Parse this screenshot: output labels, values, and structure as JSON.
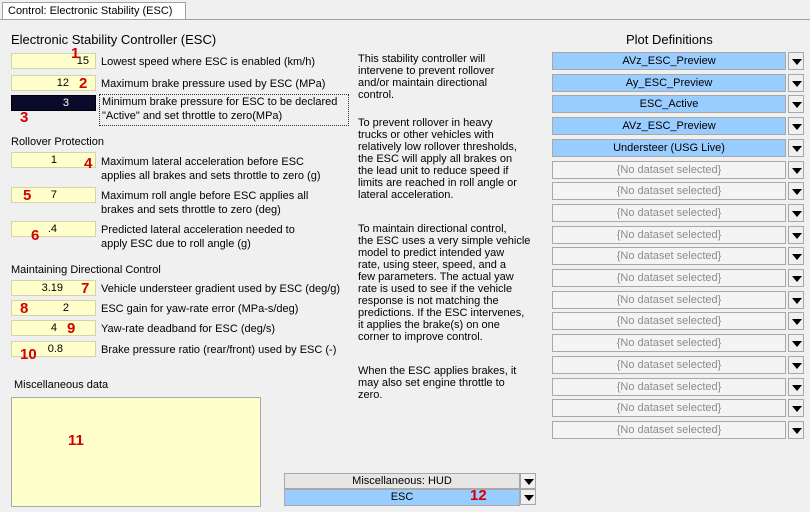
{
  "tab": {
    "label": "Control: Electronic Stability (ESC)"
  },
  "title": "Electronic Stability Controller (ESC)",
  "fields": [
    {
      "value": "15",
      "label": "Lowest speed where ESC is enabled (km/h)",
      "marker": "1"
    },
    {
      "value": "12",
      "label": "Maximum brake pressure used by ESC (MPa)",
      "marker": "2"
    },
    {
      "value": "3",
      "label_lines": [
        "Minimum brake pressure for ESC to be declared",
        "\"Active\" and set throttle to zero(MPa)"
      ],
      "marker": "3"
    }
  ],
  "rollover": {
    "heading": "Rollover Protection",
    "fields": [
      {
        "value": "1",
        "label_lines": [
          "Maximum lateral acceleration before ESC",
          "applies all brakes and sets throttle to zero (g)"
        ],
        "marker": "4"
      },
      {
        "value": "7",
        "label_lines": [
          "Maximum roll angle before ESC applies all",
          "brakes and sets throttle to zero (deg)"
        ],
        "marker": "5"
      },
      {
        "value": ".4",
        "label_lines": [
          "Predicted lateral acceleration needed to",
          "apply ESC due to roll angle (g)"
        ],
        "marker": "6"
      }
    ]
  },
  "directional": {
    "heading": "Maintaining Directional Control",
    "fields": [
      {
        "value": "3.19",
        "label": "Vehicle understeer gradient used by ESC (deg/g)",
        "marker": "7"
      },
      {
        "value": "2",
        "label": "ESC gain for yaw-rate error (MPa-s/deg)",
        "marker": "8"
      },
      {
        "value": "4",
        "label": "Yaw-rate deadband for ESC (deg/s)",
        "marker": "9"
      },
      {
        "value": "0.8",
        "label": "Brake pressure ratio (rear/front) used by ESC (-)",
        "marker": "10"
      }
    ]
  },
  "misc": {
    "heading": "Miscellaneous data",
    "marker": "11"
  },
  "description": [
    [
      "This stability controller will",
      "intervene to prevent rollover",
      "and/or maintain directional",
      "control."
    ],
    [
      "To prevent rollover in heavy",
      "trucks or other vehicles with",
      "relatively low rollover thresholds,",
      "the ESC will apply all brakes on",
      "the lead unit to reduce speed if",
      "limits are reached in roll angle or",
      "lateral acceleration."
    ],
    [
      "To maintain directional control,",
      "the ESC uses a very simple vehicle",
      "model to predict intended yaw",
      "rate, using steer, speed, and a",
      "few parameters. The actual yaw",
      "rate is used to see if the vehicle",
      "response is not matching the",
      "predictions. If the ESC intervenes,",
      "it applies the brake(s) on one",
      "corner to improve control."
    ],
    [
      "When the ESC applies brakes, it",
      "may also set engine throttle to",
      "zero."
    ]
  ],
  "plots": {
    "heading": "Plot Definitions",
    "items": [
      {
        "label": "AVz_ESC_Preview",
        "active": true
      },
      {
        "label": "Ay_ESC_Preview",
        "active": true
      },
      {
        "label": "ESC_Active",
        "active": true
      },
      {
        "label": "AVz_ESC_Preview",
        "active": true
      },
      {
        "label": "Understeer (USG Live)",
        "active": true
      },
      {
        "label": "{No dataset selected}",
        "active": false
      },
      {
        "label": "{No dataset selected}",
        "active": false
      },
      {
        "label": "{No dataset selected}",
        "active": false
      },
      {
        "label": "{No dataset selected}",
        "active": false
      },
      {
        "label": "{No dataset selected}",
        "active": false
      },
      {
        "label": "{No dataset selected}",
        "active": false
      },
      {
        "label": "{No dataset selected}",
        "active": false
      },
      {
        "label": "{No dataset selected}",
        "active": false
      },
      {
        "label": "{No dataset selected}",
        "active": false
      },
      {
        "label": "{No dataset selected}",
        "active": false
      },
      {
        "label": "{No dataset selected}",
        "active": false
      },
      {
        "label": "{No dataset selected}",
        "active": false
      },
      {
        "label": "{No dataset selected}",
        "active": false
      }
    ]
  },
  "hud": {
    "label": "Miscellaneous: HUD",
    "value": "ESC",
    "marker": "12"
  },
  "colors": {
    "field_bg": "#ffffcc",
    "active_dataset": "#99ccff",
    "marker": "#d40000",
    "selected_field": "#0a0a2a"
  }
}
